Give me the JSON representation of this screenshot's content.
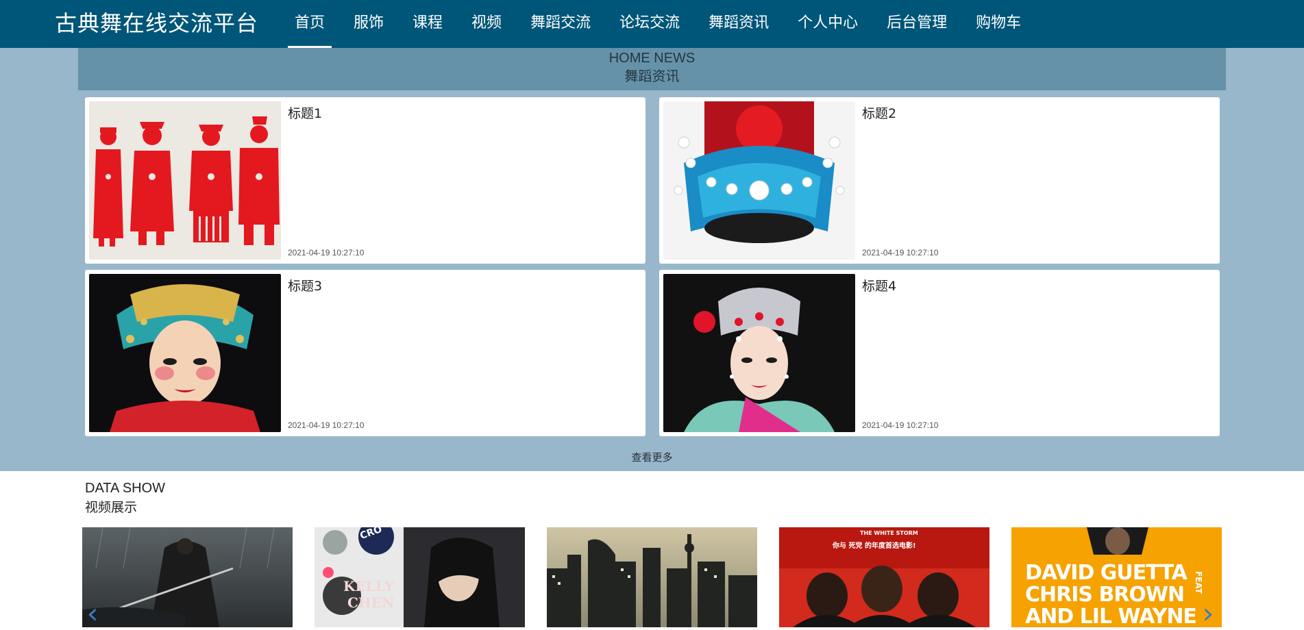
{
  "header": {
    "brand": "古典舞在线交流平台",
    "nav": [
      {
        "label": "首页",
        "active": true
      },
      {
        "label": "服饰"
      },
      {
        "label": "课程"
      },
      {
        "label": "视频"
      },
      {
        "label": "舞蹈交流"
      },
      {
        "label": "论坛交流"
      },
      {
        "label": "舞蹈资讯"
      },
      {
        "label": "个人中心"
      },
      {
        "label": "后台管理"
      },
      {
        "label": "购物车"
      }
    ]
  },
  "news": {
    "title_en": "HOME NEWS",
    "title_cn": "舞蹈资讯",
    "items": [
      {
        "title": "标题1",
        "date": "2021-04-19 10:27:10"
      },
      {
        "title": "标题2",
        "date": "2021-04-19 10:27:10"
      },
      {
        "title": "标题3",
        "date": "2021-04-19 10:27:10"
      },
      {
        "title": "标题4",
        "date": "2021-04-19 10:27:10"
      }
    ],
    "more_label": "查看更多"
  },
  "videos": {
    "title_en": "DATA SHOW",
    "title_cn": "视频展示",
    "thumb_texts": {
      "v2_top": "CRO",
      "v2_name1": "KELLY",
      "v2_name2": "CHEN",
      "v4_top": "THE WHITE STORM",
      "v4_line": "你与 死党 的年度首选电影!",
      "v5_line1": "DAVID GUETTA",
      "v5_line2": "CHRIS BROWN",
      "v5_line3": "AND LIL WAYNE",
      "v5_side": "FEAT"
    }
  },
  "colors": {
    "header_bg": "#005678",
    "news_bg": "#99b7ca",
    "news_header_bg": "#6592a9"
  }
}
